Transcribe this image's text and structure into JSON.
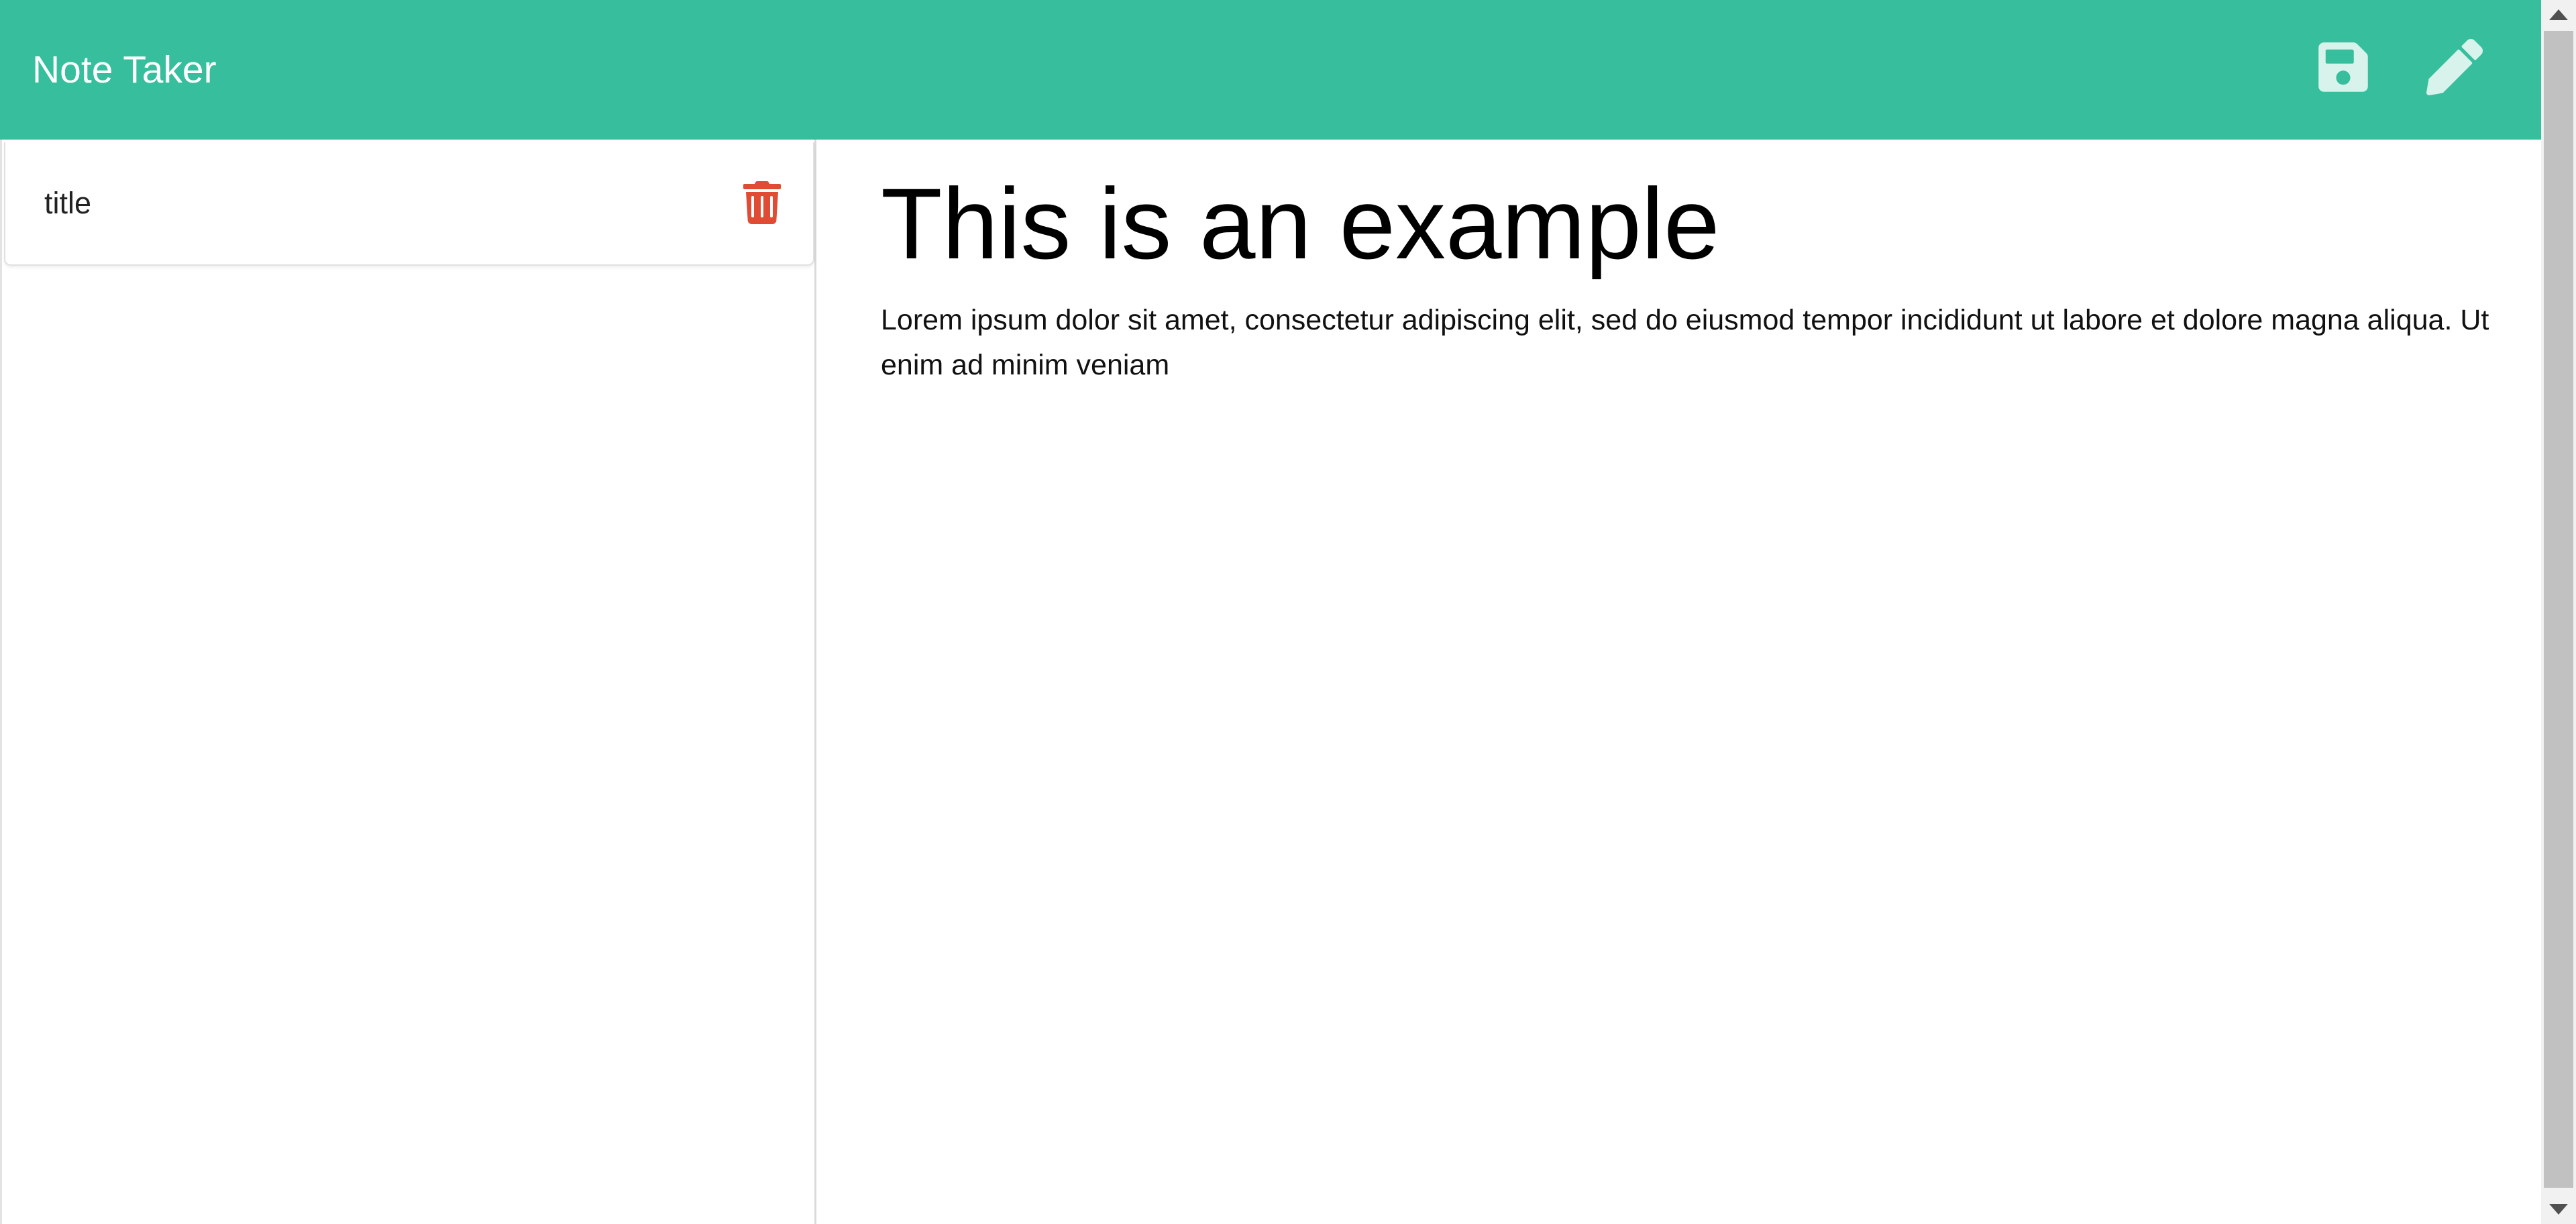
{
  "header": {
    "app_title": "Note Taker",
    "save_icon": "save-icon",
    "edit_icon": "pencil-icon",
    "background_color": "#37bf9d",
    "icon_color": "#d7f3ec"
  },
  "sidebar": {
    "notes": [
      {
        "title": "title",
        "delete_icon": "trash-icon",
        "delete_color": "#e04b33"
      }
    ]
  },
  "note": {
    "title": "This is an example",
    "body": "Lorem ipsum dolor sit amet, consectetur adipiscing elit, sed do eiusmod tempor incididunt ut labore et dolore magna aliqua. Ut enim ad minim veniam"
  },
  "scrollbar": {
    "up_icon": "arrow-up-icon",
    "down_icon": "arrow-down-icon"
  }
}
